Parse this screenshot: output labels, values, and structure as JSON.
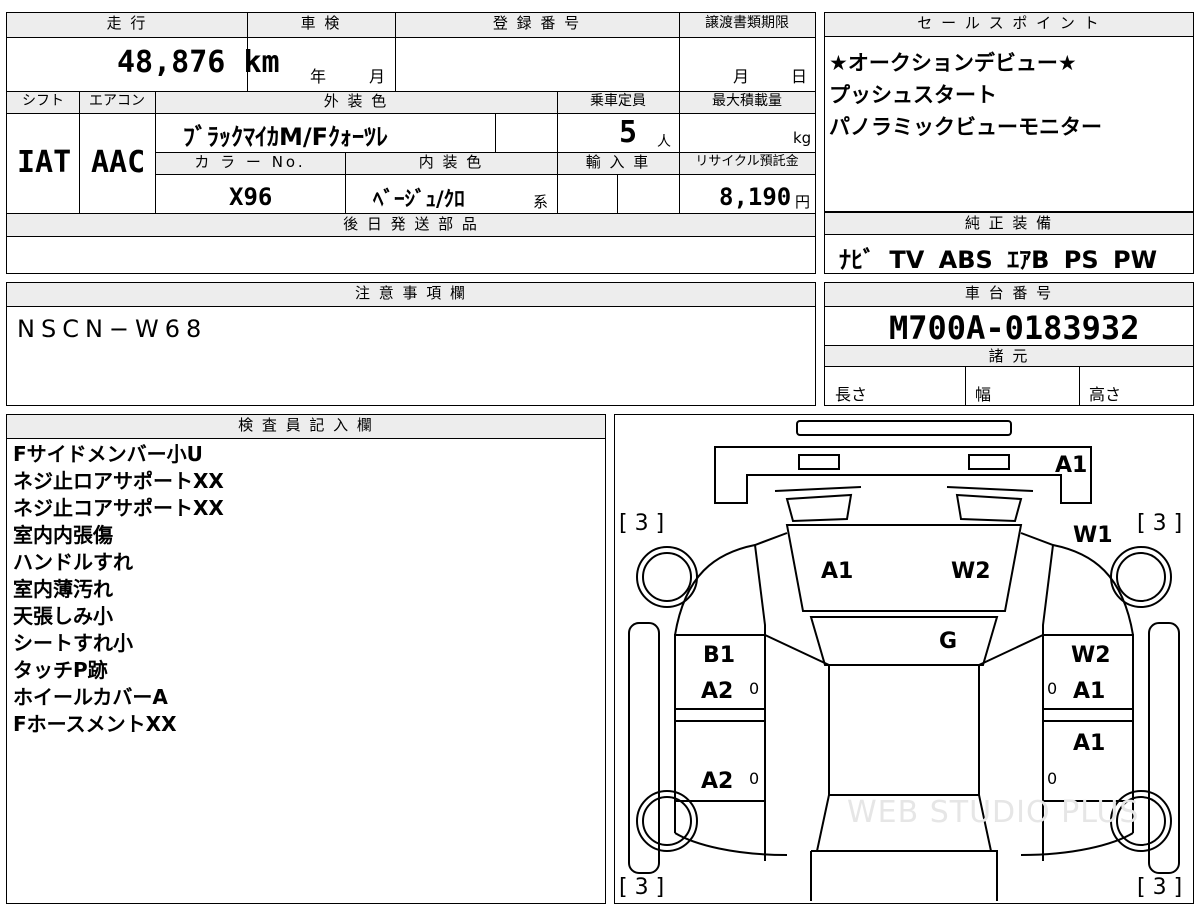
{
  "top": {
    "mileage_label": "走 行",
    "mileage_value": "48,876",
    "mileage_unit": "km",
    "shaken_label": "車 検",
    "shaken_year": "年",
    "shaken_month": "月",
    "reg_label": "登 録 番 号",
    "deadline_label": "譲渡書類期限",
    "deadline_month": "月",
    "deadline_day": "日",
    "shift_label": "シフト",
    "shift_value": "IAT",
    "ac_label": "エアコン",
    "ac_value": "AAC",
    "color_label": "外 装 色",
    "color_value": "ﾌﾞﾗｯｸﾏｲｶM/Fｸｫｰﾂﾚ",
    "capacity_label": "乗車定員",
    "capacity_value": "5",
    "capacity_unit": "人",
    "maxload_label": "最大積載量",
    "maxload_unit": "kg",
    "colorno_label": "カ ラ ー No.",
    "colorno_value": "X96",
    "interior_label": "内 装 色",
    "interior_value": "ﾍﾞｰｼﾞｭ/ｸﾛ",
    "interior_suffix": "系",
    "import_label": "輸 入 車",
    "recycle_label": "リサイクル預託金",
    "recycle_value": "8,190",
    "recycle_unit": "円",
    "parts_label": "後 日 発 送 部 品"
  },
  "sales": {
    "label": "セ ー ル ス ポ イ ン ト",
    "points": [
      "★オークションデビュー★",
      "プッシュスタート",
      "パノラミックビューモニター"
    ]
  },
  "equipment": {
    "label": "純 正 装 備",
    "items": "ﾅﾋﾞ TV ABS ｴｱB PS PW"
  },
  "notes": {
    "label": "注 意 事 項 欄",
    "value": "NSCN−W68"
  },
  "chassis": {
    "label": "車 台 番 号",
    "value": "M700A-0183932",
    "specs_label": "諸 元",
    "length_label": "長さ",
    "width_label": "幅",
    "height_label": "高さ"
  },
  "inspector": {
    "label": "検 査 員 記 入 欄",
    "lines": [
      "Fサイドメンバー小U",
      "ネジ止ロアサポートXX",
      "ネジ止コアサポートXX",
      "室内内張傷",
      "ハンドルすれ",
      "室内薄汚れ",
      "天張しみ小",
      "シートすれ小",
      "タッチP跡",
      "ホイールカバーA",
      "FホースメントXX"
    ]
  },
  "diagram": {
    "tire_fl": "[ 3 ]",
    "tire_fr": "[ 3 ]",
    "tire_rl": "[ 3 ]",
    "tire_rr": "[ 3 ]",
    "front_bumper": "A1",
    "front_right_fender": "W1",
    "hood_left": "A1",
    "hood_right": "W2",
    "windshield": "G",
    "left_front_door_1": "B1",
    "left_front_door_2": "A2",
    "left_front_door_mark": "0",
    "left_rear_door": "A2",
    "left_rear_door_mark": "0",
    "right_front_door_1": "W2",
    "right_front_door_2": "A1",
    "right_front_door_mark": "0",
    "right_rear_door": "A1",
    "right_rear_door_mark": "0",
    "watermark": "WEB STUDIO PLUS"
  }
}
